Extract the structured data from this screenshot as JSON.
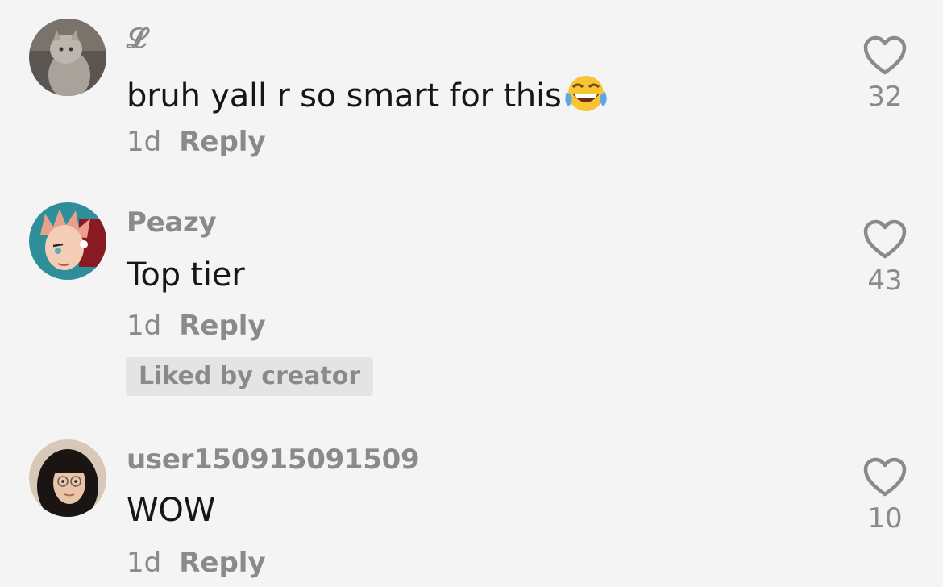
{
  "comments": [
    {
      "username": "𝓛",
      "text": "bruh yall r so smart for this",
      "emoji": "face-with-tears-of-joy",
      "time": "1d",
      "reply_label": "Reply",
      "likes": "32",
      "badge": ""
    },
    {
      "username": "Peazy",
      "text": "Top tier",
      "time": "1d",
      "reply_label": "Reply",
      "likes": "43",
      "badge": "Liked by creator"
    },
    {
      "username": "user150915091509",
      "text": "WOW",
      "time": "1d",
      "reply_label": "Reply",
      "likes": "10",
      "badge": ""
    }
  ],
  "colors": {
    "background": "#f4f4f4",
    "text_primary": "#161616",
    "text_secondary": "#8a8a8a",
    "badge_bg": "#e4e4e4"
  }
}
